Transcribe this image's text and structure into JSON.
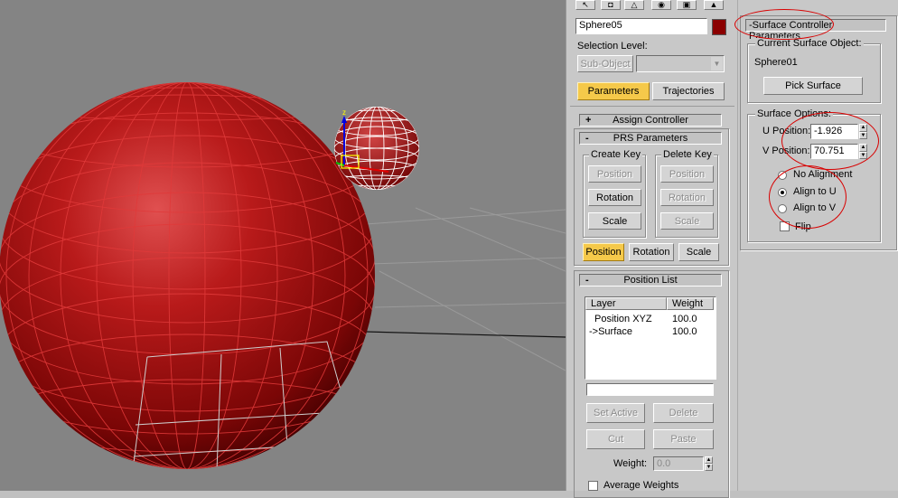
{
  "command_panel": {
    "object_name": "Sphere05",
    "object_color": "#8b0000",
    "selection_level_label": "Selection Level:",
    "sub_object_label": "Sub-Object",
    "parameters_label": "Parameters",
    "trajectories_label": "Trajectories",
    "assign_controller": {
      "sign": "+",
      "label": "Assign Controller"
    },
    "prs_parameters": {
      "sign": "-",
      "label": "PRS Parameters",
      "create_key_title": "Create Key",
      "delete_key_title": "Delete Key",
      "create_key_buttons": [
        "Position",
        "Rotation",
        "Scale"
      ],
      "delete_key_buttons": [
        "Position",
        "Rotation",
        "Scale"
      ],
      "mode_buttons": [
        "Position",
        "Rotation",
        "Scale"
      ]
    },
    "position_list": {
      "sign": "-",
      "label": "Position List",
      "columns": [
        "Layer",
        "Weight"
      ],
      "rows": [
        {
          "layer": "Position XYZ",
          "weight": "100.0"
        },
        {
          "layer": "->Surface",
          "weight": "100.0"
        }
      ],
      "set_active_label": "Set Active",
      "delete_label": "Delete",
      "cut_label": "Cut",
      "paste_label": "Paste",
      "weight_label": "Weight:",
      "weight_value": "0.0",
      "average_weights_label": "Average Weights"
    }
  },
  "surface_panel": {
    "title": "-Surface Controller Parameters",
    "current_surface_object_title": "Current Surface Object:",
    "current_surface_object": "Sphere01",
    "pick_surface_label": "Pick Surface",
    "surface_options_title": "Surface Options:",
    "u_position_label": "U Position:",
    "u_position_value": "-1.926",
    "v_position_label": "V Position:",
    "v_position_value": "70.751",
    "alignment_options": [
      "No Alignment",
      "Align to U",
      "Align to V"
    ],
    "selected_alignment": "Align to U",
    "flip_label": "Flip",
    "flip_checked": false
  },
  "colors": {
    "sphere_red": "#a01010",
    "highlight_button": "#f5c94a",
    "annotation_red": "#d80000",
    "viewport_gray": "#848484"
  },
  "icons": [
    "select-icon",
    "modify-icon",
    "hierarchy-icon",
    "motion-icon",
    "display-icon",
    "utilities-icon"
  ]
}
